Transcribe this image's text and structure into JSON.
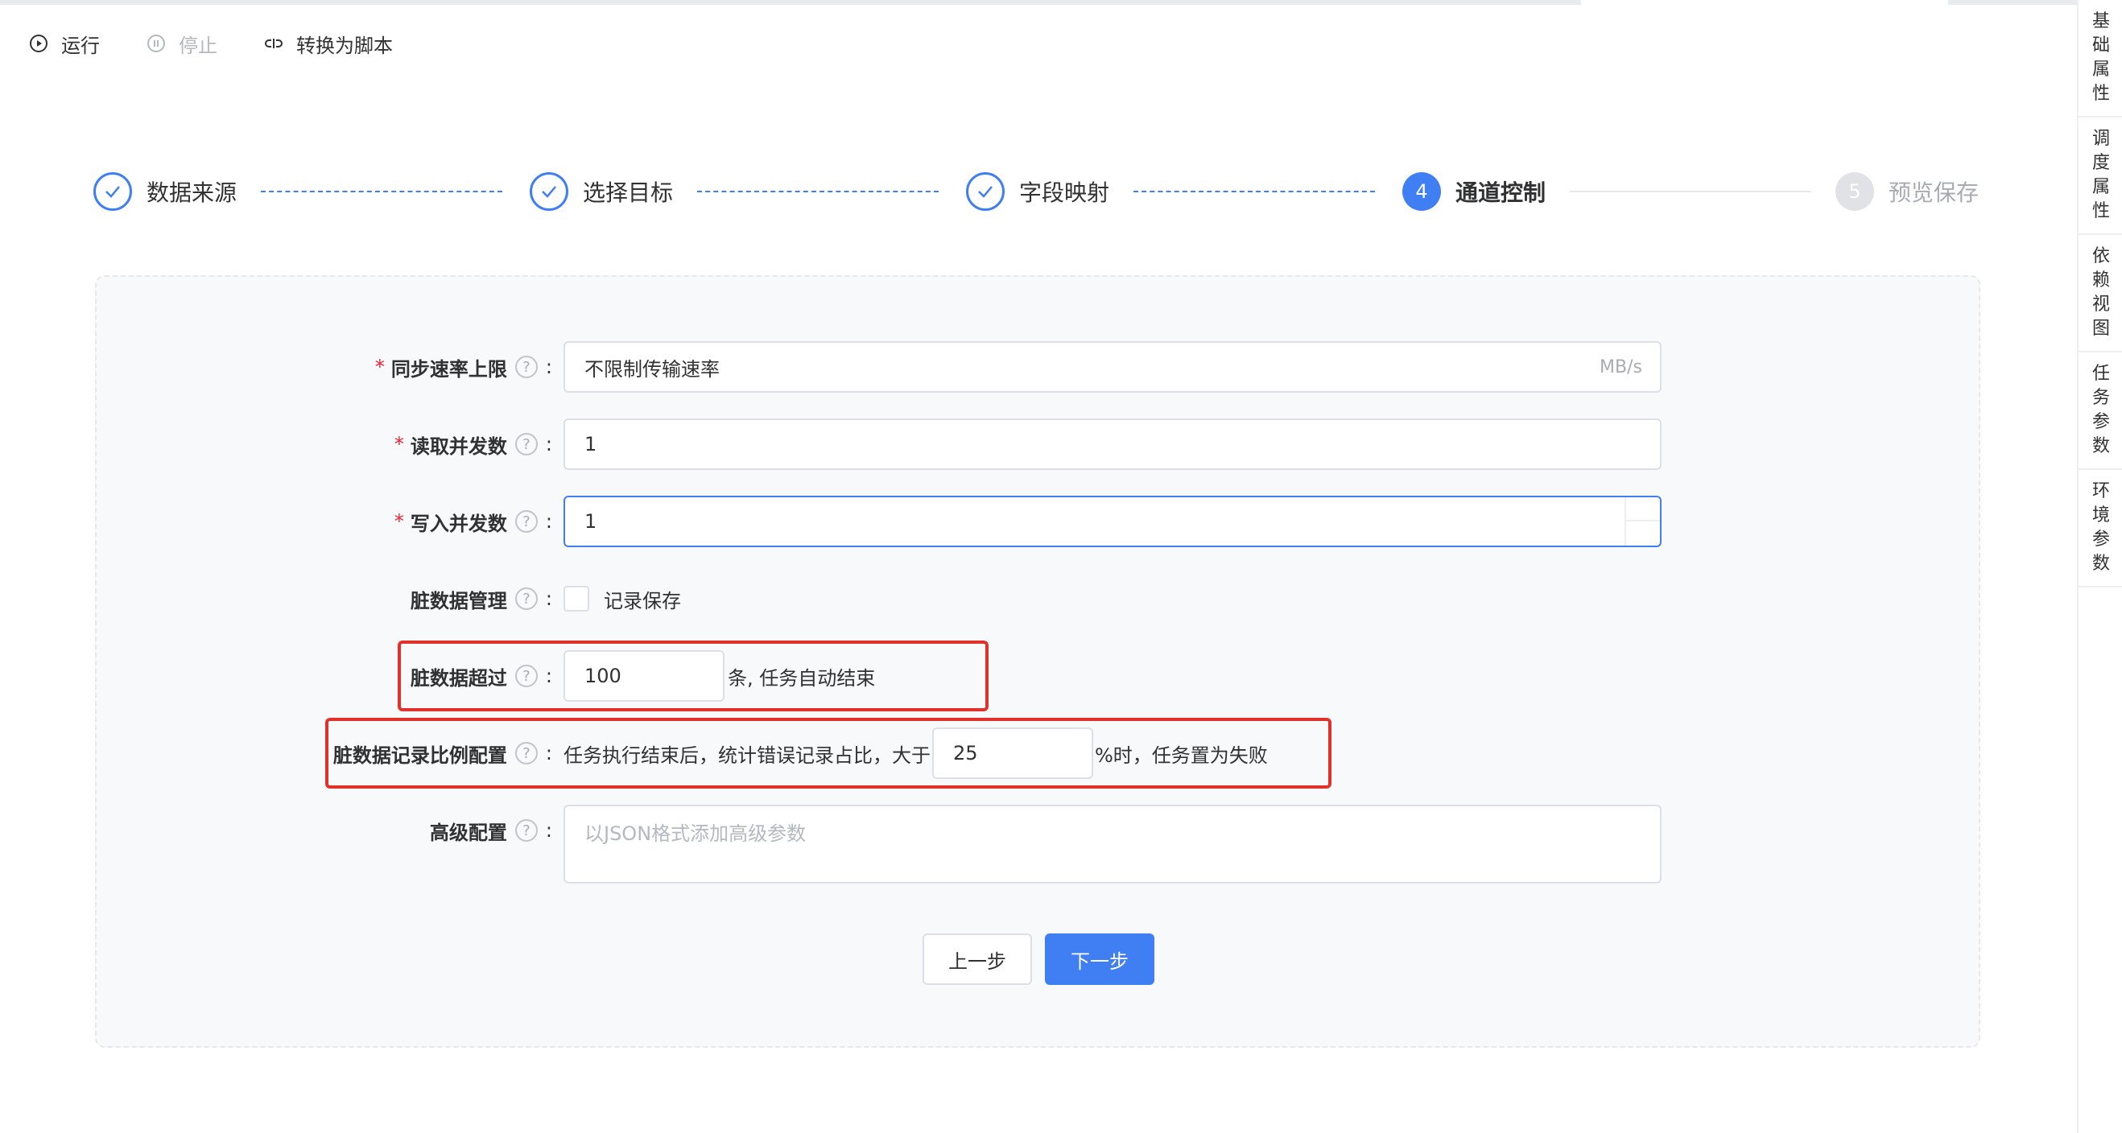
{
  "toolbar": {
    "run": "运行",
    "stop": "停止",
    "convert": "转换为脚本"
  },
  "side_panel": [
    {
      "chars": [
        "基",
        "础",
        "属",
        "性"
      ]
    },
    {
      "chars": [
        "调",
        "度",
        "属",
        "性"
      ]
    },
    {
      "chars": [
        "依",
        "赖",
        "视",
        "图"
      ]
    },
    {
      "chars": [
        "任",
        "务",
        "参",
        "数"
      ]
    },
    {
      "chars": [
        "环",
        "境",
        "参",
        "数"
      ]
    }
  ],
  "steps": [
    {
      "label": "数据来源",
      "status": "done"
    },
    {
      "label": "选择目标",
      "status": "done"
    },
    {
      "label": "字段映射",
      "status": "done"
    },
    {
      "label": "通道控制",
      "status": "active",
      "number": "4"
    },
    {
      "label": "预览保存",
      "status": "wait",
      "number": "5"
    }
  ],
  "form": {
    "rate_limit": {
      "label": "同步速率上限",
      "value": "不限制传输速率",
      "suffix": "MB/s",
      "required": "*"
    },
    "read_concurrency": {
      "label": "读取并发数",
      "value": "1",
      "required": "*"
    },
    "write_concurrency": {
      "label": "写入并发数",
      "value": "1",
      "required": "*"
    },
    "dirty_management": {
      "label": "脏数据管理",
      "checkbox_label": "记录保存",
      "checked": false
    },
    "dirty_exceed": {
      "label": "脏数据超过",
      "value": "100",
      "after": "条, 任务自动结束"
    },
    "dirty_ratio": {
      "label": "脏数据记录比例配置",
      "before": "任务执行结束后，统计错误记录占比，大于",
      "value": "25",
      "after": "%时，任务置为失败"
    },
    "advanced": {
      "label": "高级配置",
      "placeholder": "以JSON格式添加高级参数"
    },
    "help_symbol": "?",
    "colon": ":"
  },
  "buttons": {
    "prev": "上一步",
    "next": "下一步"
  },
  "colors": {
    "primary": "#3f7ef3",
    "highlight": "#e0322b",
    "required": "#f5222d"
  }
}
